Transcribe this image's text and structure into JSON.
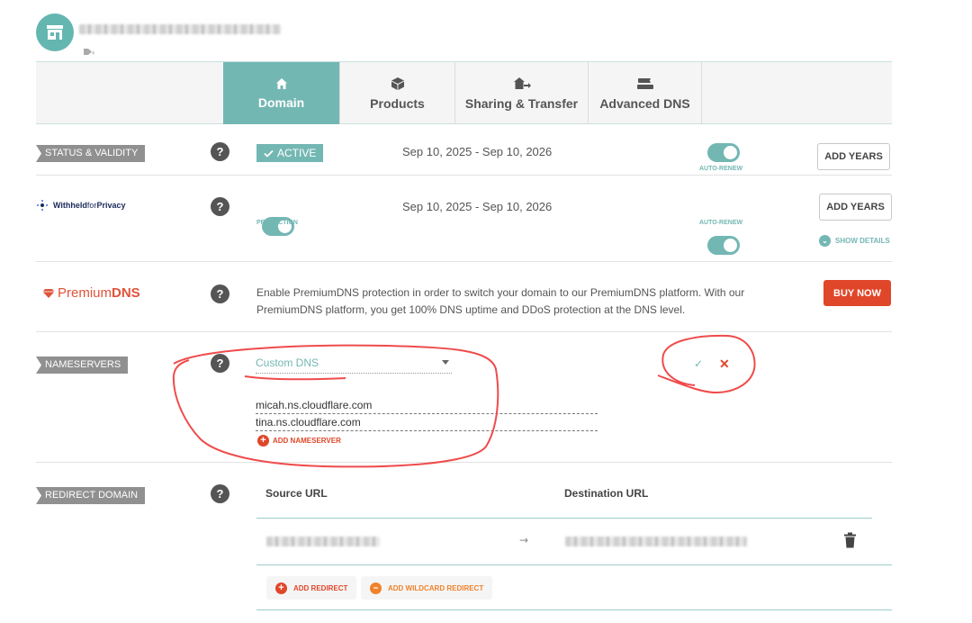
{
  "tabs": [
    {
      "label": "Domain",
      "icon": "home-icon",
      "active": true
    },
    {
      "label": "Products",
      "icon": "box-icon",
      "active": false
    },
    {
      "label": "Sharing & Transfer",
      "icon": "house-arrow-icon",
      "active": false
    },
    {
      "label": "Advanced DNS",
      "icon": "server-icon",
      "active": false
    }
  ],
  "status": {
    "label": "STATUS & VALIDITY",
    "help": "?",
    "badge": "ACTIVE",
    "dates": "Sep 10, 2025 - Sep 10, 2026",
    "autorenew_caption": "AUTO-RENEW",
    "add_years": "ADD YEARS"
  },
  "privacy": {
    "brand_bold": "Withheld",
    "brand_light": "for",
    "brand_end": "Privacy",
    "help": "?",
    "protection_caption": "PROTECTION",
    "dates": "Sep 10, 2025 - Sep 10, 2026",
    "autorenew_caption": "AUTO-RENEW",
    "add_years": "ADD YEARS",
    "show_details": "SHOW DETAILS"
  },
  "premium": {
    "brand_light": "Premium",
    "brand_bold": "DNS",
    "help": "?",
    "description": "Enable PremiumDNS protection in order to switch your domain to our PremiumDNS platform. With our PremiumDNS platform, you get 100% DNS uptime and DDoS protection at the DNS level.",
    "buy_now": "BUY NOW"
  },
  "nameservers": {
    "label": "NAMESERVERS",
    "help": "?",
    "selected": "Custom DNS",
    "servers": [
      "micah.ns.cloudflare.com",
      "tina.ns.cloudflare.com"
    ],
    "add_label": "ADD NAMESERVER",
    "confirm": "✓",
    "cancel": "✕"
  },
  "redirect": {
    "label": "REDIRECT DOMAIN",
    "help": "?",
    "source_header": "Source URL",
    "destination_header": "Destination URL",
    "arrow": "→",
    "add_redirect": "ADD REDIRECT",
    "add_wildcard": "ADD WILDCARD REDIRECT"
  },
  "colors": {
    "teal": "#73b7b3",
    "red": "#e0472a",
    "annotation": "#ef4b4b"
  }
}
